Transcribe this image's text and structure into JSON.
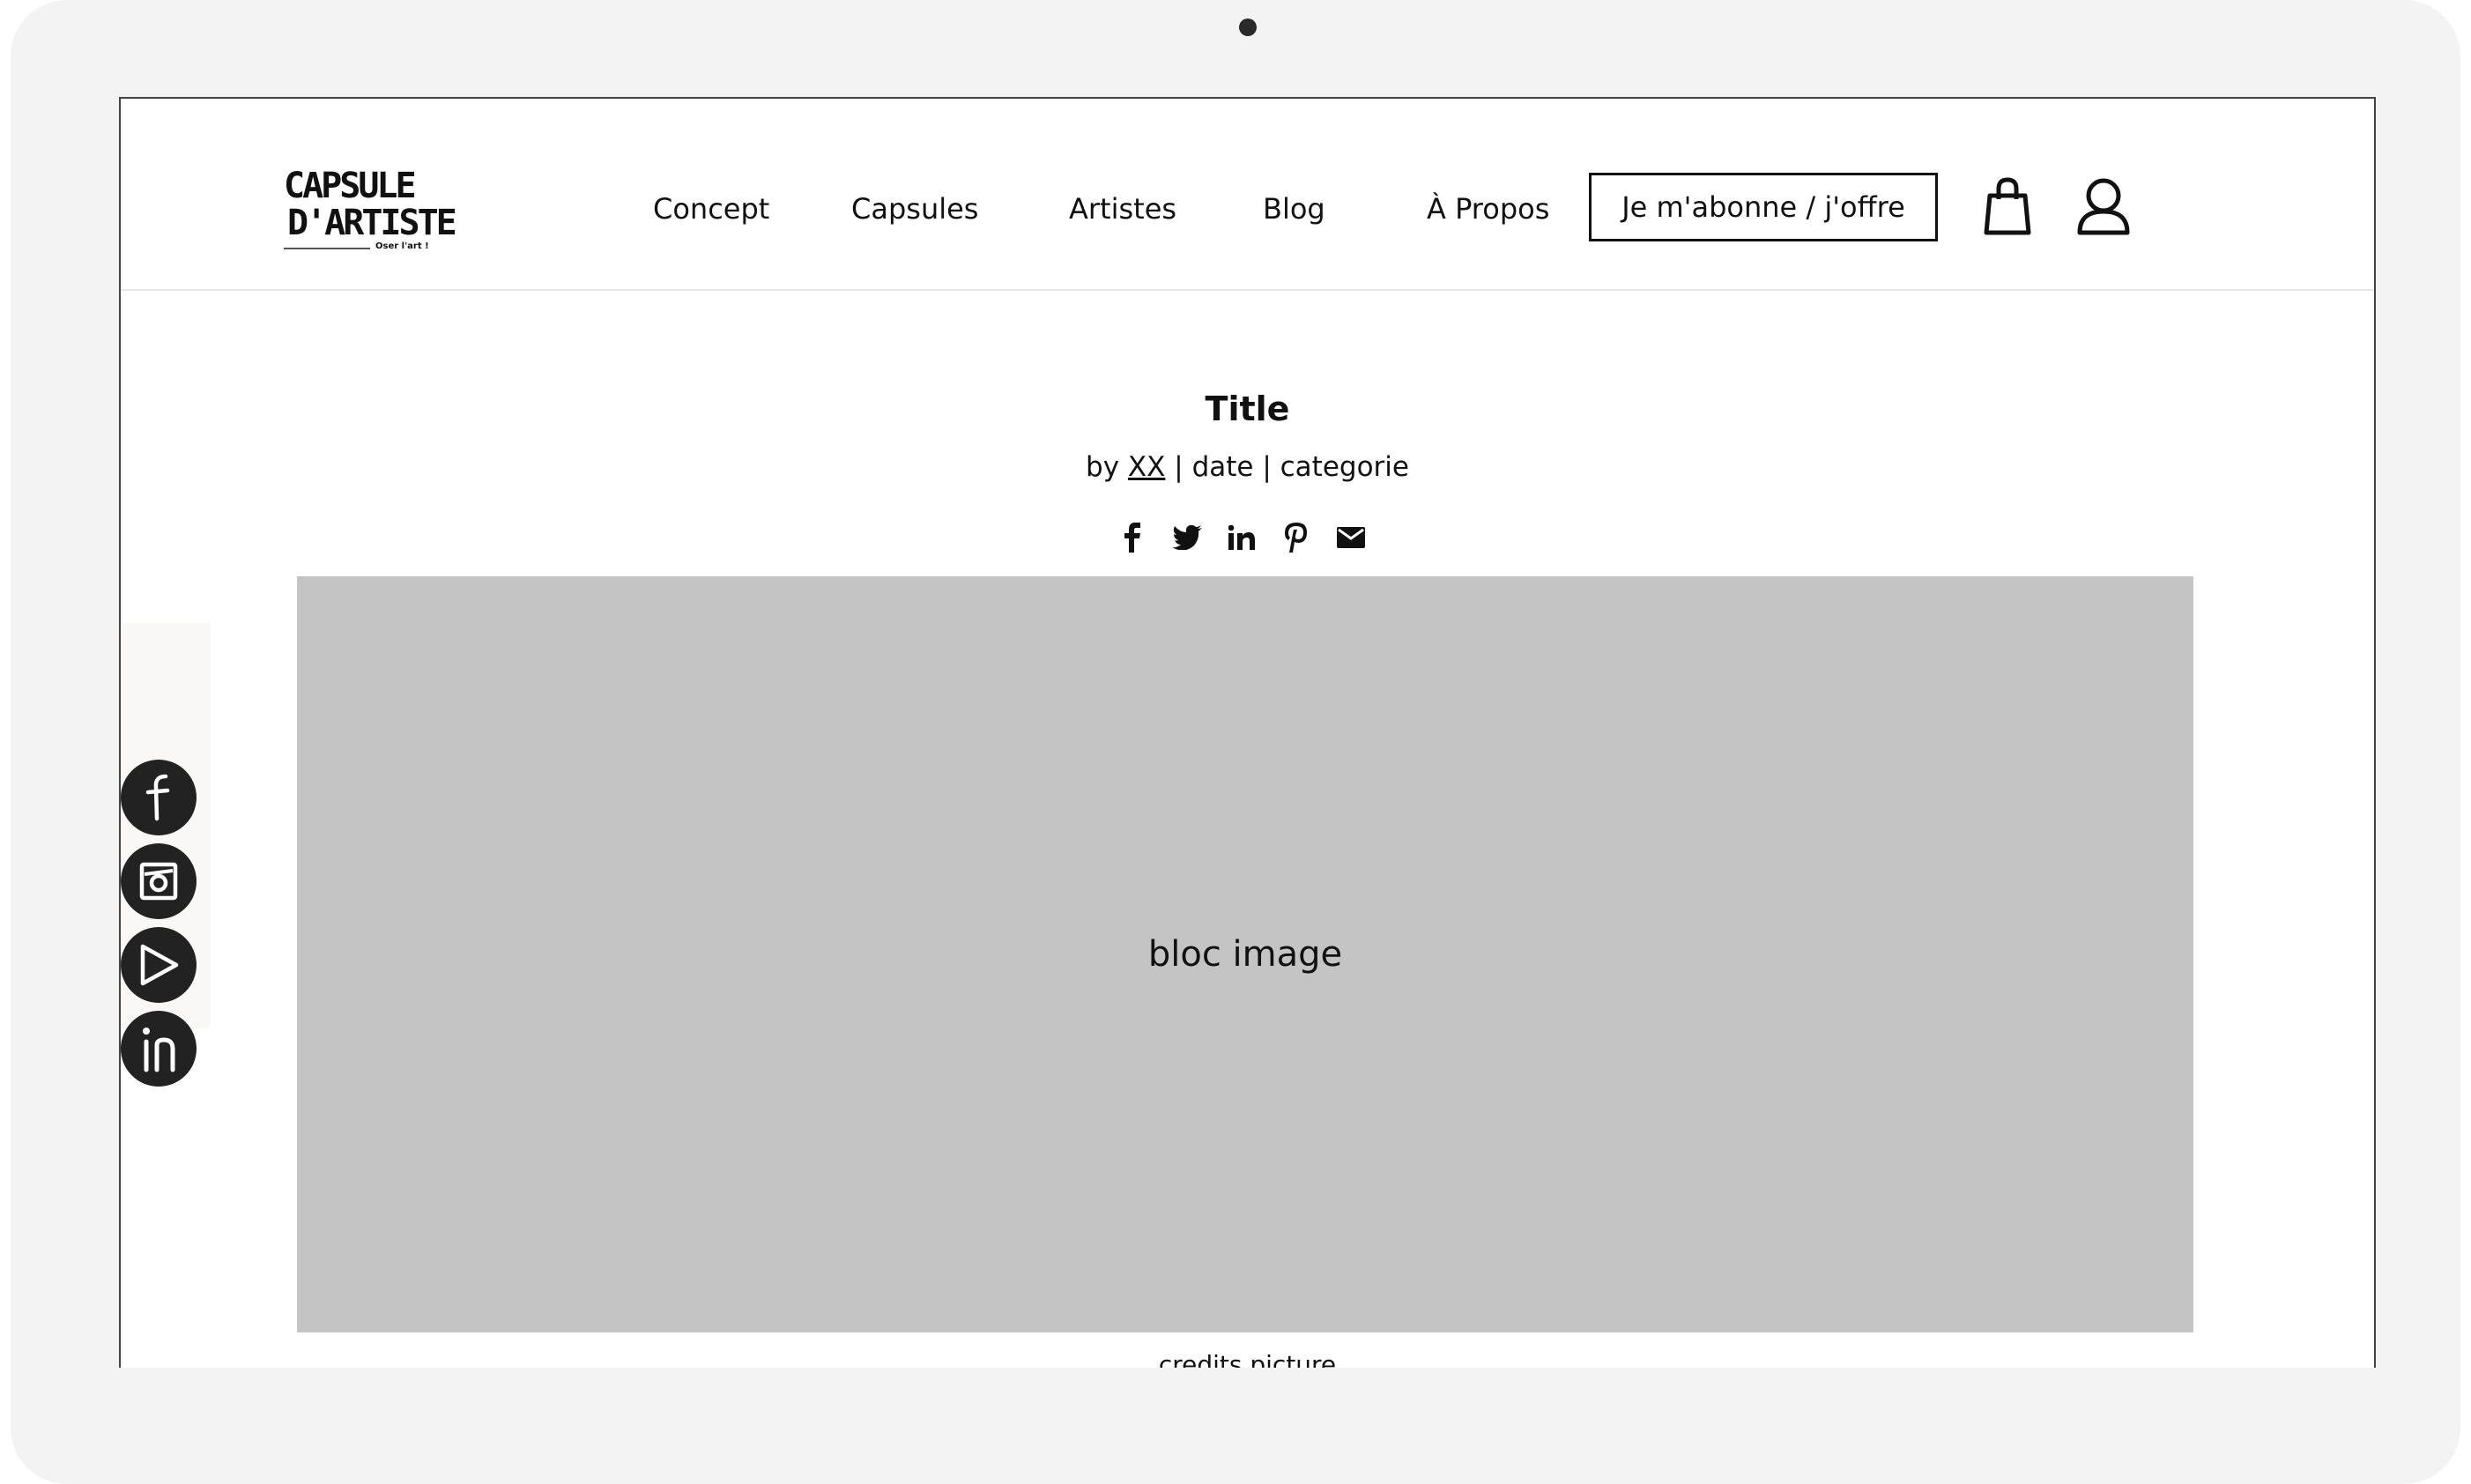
{
  "logo": {
    "line1": "CAPSULE",
    "line2": "D'ARTISTE",
    "tagline": "Oser l'art !"
  },
  "nav": {
    "items": [
      "Concept",
      "Capsules",
      "Artistes",
      "Blog",
      "À Propos"
    ]
  },
  "cta": {
    "label": "Je m'abonne / j'offre"
  },
  "header_icons": [
    "shopping-bag-icon",
    "user-icon"
  ],
  "article": {
    "title": "Title",
    "by": "by",
    "author": "XX",
    "separator": "|",
    "date": "date",
    "category": "categorie",
    "share_icons": [
      "facebook-icon",
      "twitter-icon",
      "linkedin-icon",
      "pinterest-icon",
      "email-icon"
    ]
  },
  "image_block": {
    "label": "bloc image",
    "credits": "credits picture"
  },
  "side_social": [
    "facebook-icon",
    "instagram-icon",
    "play-icon",
    "linkedin-icon"
  ],
  "colors": {
    "frame": "#f3f3f3",
    "image_placeholder": "#c4c4c4",
    "dark": "#222222"
  }
}
